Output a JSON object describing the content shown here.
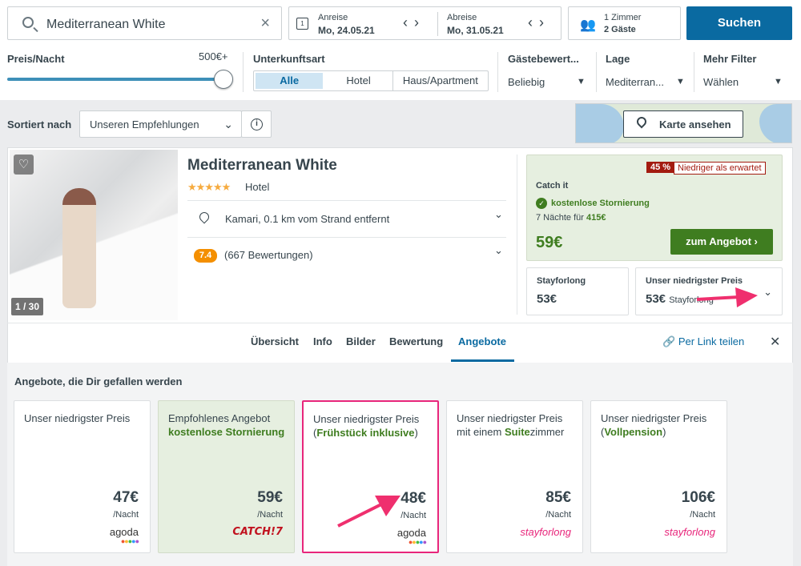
{
  "search": {
    "query": "Mediterranean White"
  },
  "dates": {
    "checkin_label": "Anreise",
    "checkin_value": "Mo, 24.05.21",
    "checkout_label": "Abreise",
    "checkout_value": "Mo, 31.05.21",
    "calendar_day": "1"
  },
  "guests": {
    "rooms": "1 Zimmer",
    "persons": "2 Gäste"
  },
  "search_button": "Suchen",
  "filters": {
    "price_label": "Preis/Nacht",
    "price_value": "500€+",
    "price_slider_fraction": 1.0,
    "type_label": "Unterkunftsart",
    "type_options": [
      "Alle",
      "Hotel",
      "Haus/Apartment"
    ],
    "rating_label": "Gästebewert...",
    "rating_value": "Beliebig",
    "location_label": "Lage",
    "location_value": "Mediterran...",
    "more_label": "Mehr Filter",
    "more_value": "Wählen"
  },
  "sort": {
    "label": "Sortiert nach",
    "value": "Unseren Empfehlungen"
  },
  "map_button": "Karte ansehen",
  "hotel": {
    "photo_count": "1 / 30",
    "name": "Mediterranean White",
    "stars": "★★★★★",
    "type": "Hotel",
    "location": "Kamari, 0.1 km vom Strand entfernt",
    "rating": "7.4",
    "reviews": "(667 Bewertungen)"
  },
  "deal": {
    "percent": "45 %",
    "badge": "Niedriger als erwartet",
    "provider": "Catch it",
    "cancellation": "kostenlose Stornierung",
    "nights_text": "7 Nächte für",
    "nights_total": "415€",
    "price": "59€",
    "cta": "zum Angebot"
  },
  "alt_prices": [
    {
      "name": "Stayforlong",
      "price": "53€",
      "sub": ""
    },
    {
      "name": "Unser niedrigster Preis",
      "price": "53€",
      "sub": "Stayforlong"
    }
  ],
  "tabs": [
    "Übersicht",
    "Info",
    "Bilder",
    "Bewertung",
    "Angebote"
  ],
  "active_tab": "Angebote",
  "share": "Per Link teilen",
  "offers_title": "Angebote, die Dir gefallen werden",
  "offers": [
    {
      "line1": "Unser niedrigster Preis",
      "pre": "",
      "bold": "",
      "post": "",
      "price": "47€",
      "per": "/Nacht",
      "logo": "agoda"
    },
    {
      "line1": "Empfohlenes Angebot",
      "pre": "",
      "bold": "kostenlose Stornierung",
      "post": "",
      "price": "59€",
      "per": "/Nacht",
      "logo": "CATCH!7"
    },
    {
      "line1": "Unser niedrigster Preis",
      "pre": "(",
      "bold": "Frühstück inklusive",
      "post": ")",
      "price": "48€",
      "per": "/Nacht",
      "logo": "agoda"
    },
    {
      "line1": "Unser niedrigster Preis",
      "pre": "mit einem ",
      "bold": "Suite",
      "post": "zimmer",
      "price": "85€",
      "per": "/Nacht",
      "logo": "stayforlong"
    },
    {
      "line1": "Unser niedrigster Preis",
      "pre": "(",
      "bold": "Vollpension",
      "post": ")",
      "price": "106€",
      "per": "/Nacht",
      "logo": "stayforlong"
    }
  ],
  "colors": {
    "primary": "#0a6aa1",
    "green": "#3f7d20",
    "highlight": "#e8267b",
    "badge_red": "#a31b10"
  }
}
